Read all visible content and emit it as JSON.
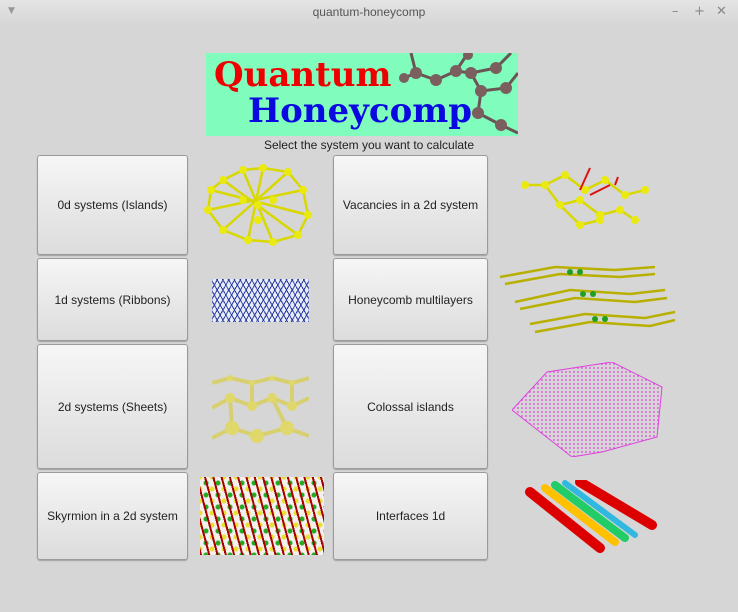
{
  "window": {
    "title": "quantum-honeycomp",
    "menu_icon": "triangle-down",
    "minimize": "–",
    "maximize": "+",
    "close": "✕"
  },
  "logo": {
    "line1": "Quantum",
    "line2": "Honeycomp"
  },
  "subtitle": "Select the system you want to calculate",
  "buttons": {
    "islands": "0d systems (Islands)",
    "ribbons": "1d systems (Ribbons)",
    "sheets": "2d systems (Sheets)",
    "skyrmion": "Skyrmion in a 2d system",
    "vacancies": "Vacancies in a 2d system",
    "multilayers": "Honeycomb multilayers",
    "colossal": "Colossal islands",
    "interfaces": "Interfaces 1d"
  }
}
